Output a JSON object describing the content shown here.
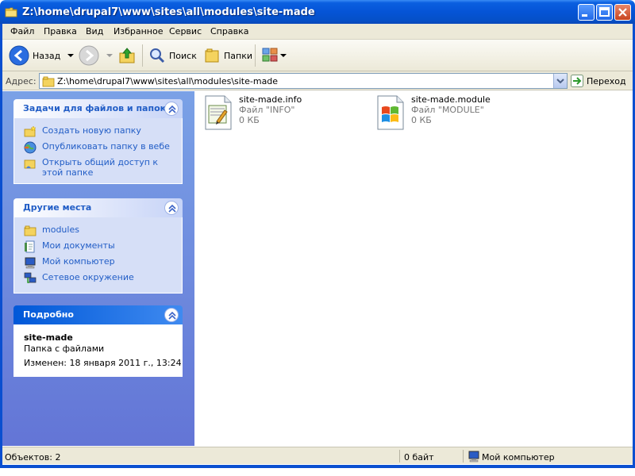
{
  "window": {
    "title": "Z:\\home\\drupal7\\www\\sites\\all\\modules\\site-made"
  },
  "menu": [
    "Файл",
    "Правка",
    "Вид",
    "Избранное",
    "Сервис",
    "Справка"
  ],
  "toolbar": {
    "back_label": "Назад",
    "search_label": "Поиск",
    "folders_label": "Папки"
  },
  "address": {
    "label": "Адрес:",
    "value": "Z:\\home\\drupal7\\www\\sites\\all\\modules\\site-made",
    "go_label": "Переход"
  },
  "tasks": {
    "title": "Задачи для файлов и папок",
    "items": [
      {
        "label": "Создать новую папку",
        "icon": "new-folder-icon"
      },
      {
        "label": "Опубликовать папку в вебе",
        "icon": "publish-web-icon"
      },
      {
        "label": "Открыть общий доступ к этой папке",
        "icon": "share-folder-icon"
      }
    ]
  },
  "places": {
    "title": "Другие места",
    "items": [
      {
        "label": "modules",
        "icon": "folder-icon"
      },
      {
        "label": "Мои документы",
        "icon": "my-documents-icon"
      },
      {
        "label": "Мой компьютер",
        "icon": "my-computer-icon"
      },
      {
        "label": "Сетевое окружение",
        "icon": "network-icon"
      }
    ]
  },
  "details": {
    "title": "Подробно",
    "name": "site-made",
    "type": "Папка с файлами",
    "modified": "Изменен: 18 января 2011 г., 13:24"
  },
  "files": [
    {
      "name": "site-made.info",
      "type": "Файл \"INFO\"",
      "size": "0 КБ",
      "icon": "text-file-icon"
    },
    {
      "name": "site-made.module",
      "type": "Файл \"MODULE\"",
      "size": "0 КБ",
      "icon": "windows-file-icon"
    }
  ],
  "status": {
    "objects": "Объектов: 2",
    "size": "0 байт",
    "location": "Мой компьютер"
  }
}
